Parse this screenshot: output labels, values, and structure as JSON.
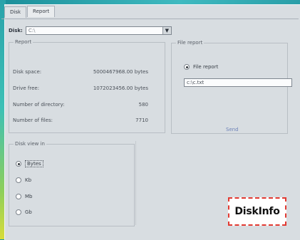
{
  "tabs": [
    {
      "label": "Disk",
      "active": false
    },
    {
      "label": "Report",
      "active": true
    }
  ],
  "drive": {
    "label": "Disk:",
    "value": "C:\\",
    "dropdown_icon": "chevron-down-icon"
  },
  "report": {
    "legend": "Report",
    "rows": [
      {
        "label": "Disk space:",
        "value": "5000467968.00 bytes"
      },
      {
        "label": "Drive free:",
        "value": "1072023456.00 bytes"
      },
      {
        "label": "Number of directory:",
        "value": "580"
      },
      {
        "label": "Number of files:",
        "value": "7710"
      }
    ]
  },
  "file_report": {
    "legend": "File report",
    "checkbox_label": "File report",
    "checked": true,
    "path_value": "c:\\c.txt",
    "send_label": "Send"
  },
  "disk_view": {
    "legend": "Disk view in",
    "options": [
      {
        "label": "Bytes",
        "selected": true
      },
      {
        "label": "Kb",
        "selected": false
      },
      {
        "label": "Mb",
        "selected": false
      },
      {
        "label": "Gb",
        "selected": false
      }
    ]
  },
  "badge": {
    "text": "DiskInfo"
  },
  "colors": {
    "window_bg": "#d8dde1",
    "desktop": "#1e9aa6",
    "badge_border": "#e23a32",
    "send_link": "#6e83b8"
  }
}
